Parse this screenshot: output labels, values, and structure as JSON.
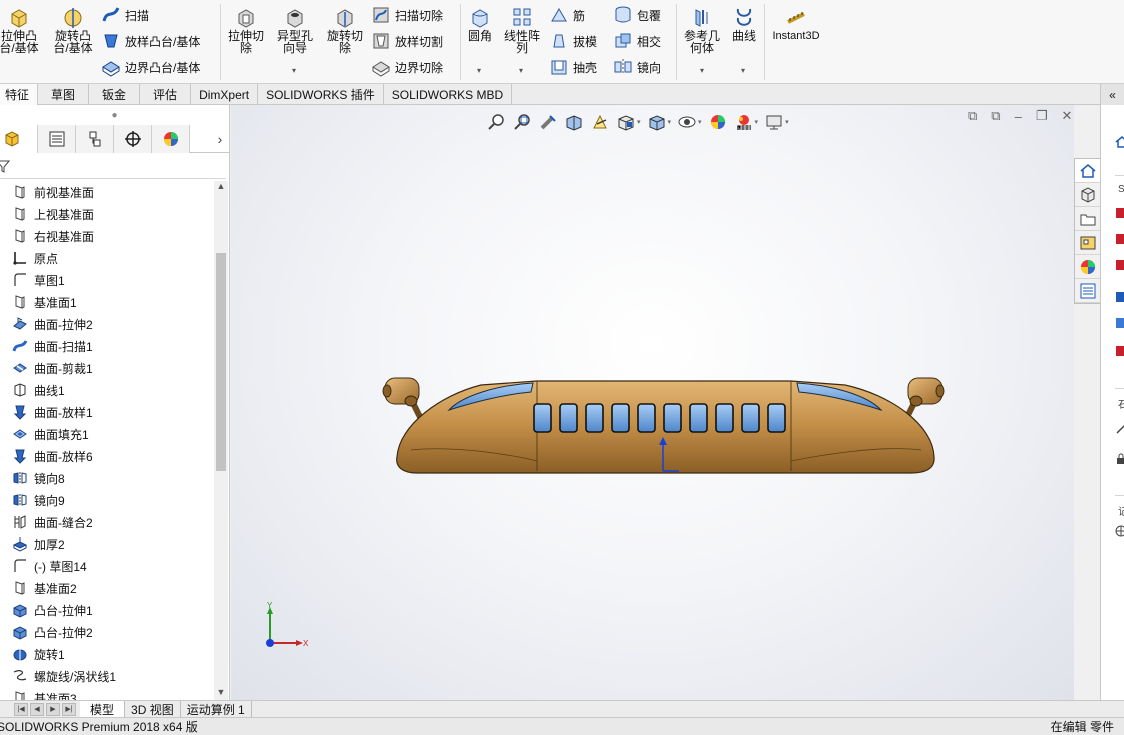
{
  "app": {
    "status_left": "SOLIDWORKS Premium 2018 x64 版",
    "status_right": "在编辑 零件"
  },
  "ribbon": {
    "extrude_boss": "拉伸凸台/基体",
    "revolve_boss": "旋转凸台/基体",
    "sweep": "扫描",
    "loft_boss": "放样凸台/基体",
    "boundary_boss": "边界凸台/基体",
    "extrude_cut": "拉伸切除",
    "hole_wizard": "异型孔向导",
    "revolve_cut": "旋转切除",
    "swept_cut": "扫描切除",
    "lofted_cut": "放样切割",
    "boundary_cut": "边界切除",
    "fillet": "圆角",
    "linear_pattern": "线性阵列",
    "rib": "筋",
    "draft": "拔模",
    "shell": "抽壳",
    "wrap": "包覆",
    "intersect": "相交",
    "mirror": "镜向",
    "ref_geometry": "参考几何体",
    "curves": "曲线",
    "instant3d": "Instant3D"
  },
  "tabs": [
    "特征",
    "草图",
    "钣金",
    "评估",
    "DimXpert",
    "SOLIDWORKS 插件",
    "SOLIDWORKS MBD"
  ],
  "tree": [
    {
      "label": "前视基准面",
      "icon": "plane-icon"
    },
    {
      "label": "上视基准面",
      "icon": "plane-icon"
    },
    {
      "label": "右视基准面",
      "icon": "plane-icon"
    },
    {
      "label": "原点",
      "icon": "origin-icon"
    },
    {
      "label": "草图1",
      "icon": "sketch-icon"
    },
    {
      "label": "基准面1",
      "icon": "plane-icon"
    },
    {
      "label": "曲面-拉伸2",
      "icon": "surface-extrude-icon"
    },
    {
      "label": "曲面-扫描1",
      "icon": "surface-sweep-icon"
    },
    {
      "label": "曲面-剪裁1",
      "icon": "surface-trim-icon"
    },
    {
      "label": "曲线1",
      "icon": "curve-icon"
    },
    {
      "label": "曲面-放样1",
      "icon": "surface-loft-icon"
    },
    {
      "label": "曲面填充1",
      "icon": "surface-fill-icon"
    },
    {
      "label": "曲面-放样6",
      "icon": "surface-loft-icon"
    },
    {
      "label": "镜向8",
      "icon": "mirror-icon"
    },
    {
      "label": "镜向9",
      "icon": "mirror-icon"
    },
    {
      "label": "曲面-缝合2",
      "icon": "knit-icon"
    },
    {
      "label": "加厚2",
      "icon": "thicken-icon"
    },
    {
      "label": "(-) 草图14",
      "icon": "sketch-icon"
    },
    {
      "label": "基准面2",
      "icon": "plane-icon"
    },
    {
      "label": "凸台-拉伸1",
      "icon": "boss-extrude-icon"
    },
    {
      "label": "凸台-拉伸2",
      "icon": "boss-extrude-icon"
    },
    {
      "label": "旋转1",
      "icon": "revolve-icon"
    },
    {
      "label": "螺旋线/涡状线1",
      "icon": "helix-icon"
    },
    {
      "label": "基准面3",
      "icon": "plane-icon"
    }
  ],
  "bottom_tabs": [
    "模型",
    "3D 视图",
    "运动算例 1"
  ],
  "triad": {
    "y": "Y",
    "x": "X"
  },
  "taskpane": {
    "label_s": "S",
    "label_a": "石",
    "label_b": "记"
  },
  "colors": {
    "accent": "#1e5bb8",
    "body": "#b8843f",
    "window": "#7fb0e6"
  }
}
